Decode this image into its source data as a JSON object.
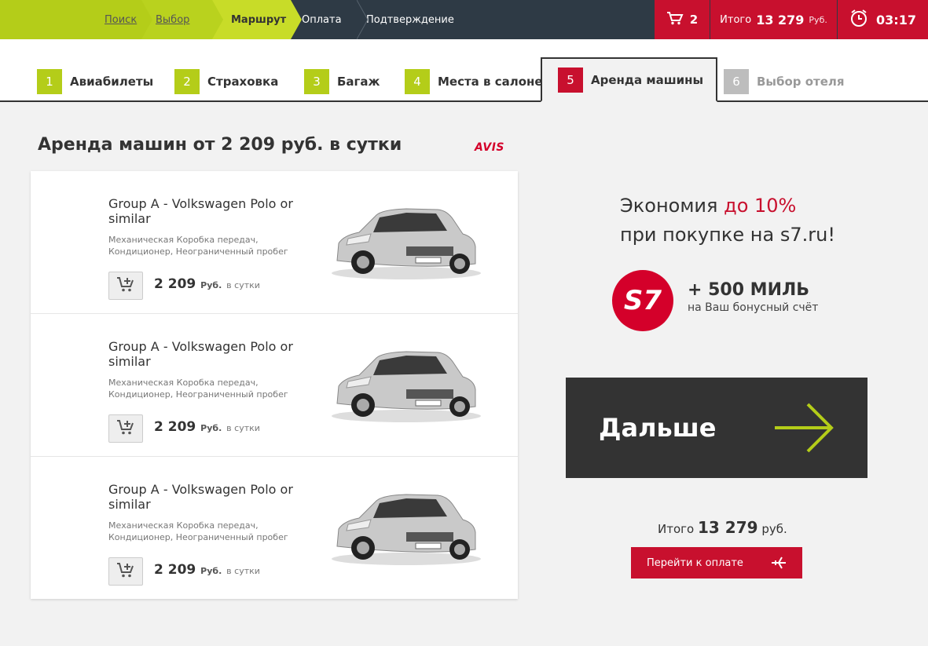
{
  "breadcrumbs": {
    "search": "Поиск",
    "choice": "Выбор",
    "route": "Маршрут",
    "payment": "Оплата",
    "confirm": "Подтверждение"
  },
  "header": {
    "cart_count": "2",
    "total_label": "Итого",
    "total_amount": "13 279",
    "total_currency": "Руб.",
    "timer": "03:17"
  },
  "tabs": [
    {
      "num": "1",
      "label": "Авиабилеты"
    },
    {
      "num": "2",
      "label": "Страховка"
    },
    {
      "num": "3",
      "label": "Багаж"
    },
    {
      "num": "4",
      "label": "Места в салоне"
    },
    {
      "num": "5",
      "label": "Аренда машины"
    },
    {
      "num": "6",
      "label": "Выбор отеля"
    }
  ],
  "main": {
    "heading": "Аренда машин от 2 209 руб. в сутки",
    "brand": "AVIS"
  },
  "cars": [
    {
      "title": "Group A - Volkswagen Polo or similar",
      "desc": "Механическая Коробка передач, Кондиционер, Неограниченный пробег",
      "price": "2 209",
      "currency": "Руб.",
      "per": "в сутки"
    },
    {
      "title": "Group A - Volkswagen Polo or similar",
      "desc": "Механическая Коробка передач, Кондиционер, Неограниченный пробег",
      "price": "2 209",
      "currency": "Руб.",
      "per": "в сутки"
    },
    {
      "title": "Group A - Volkswagen Polo or similar",
      "desc": "Механическая Коробка передач, Кондиционер, Неограниченный пробег",
      "price": "2 209",
      "currency": "Руб.",
      "per": "в сутки"
    }
  ],
  "promo": {
    "line1_a": "Экономия ",
    "line1_b": "до 10%",
    "line2": "при покупке на s7.ru!",
    "logo_text": "S7",
    "miles": "+ 500 МИЛЬ",
    "miles_sub": "на Ваш бонусный счёт"
  },
  "actions": {
    "next_label": "Дальше",
    "total_label": "Итого",
    "total_amount": "13 279",
    "total_currency": "руб.",
    "pay_label": "Перейти к оплате"
  },
  "colors": {
    "accent_green": "#b4cd19",
    "accent_red": "#c8102e",
    "dark": "#333333"
  }
}
